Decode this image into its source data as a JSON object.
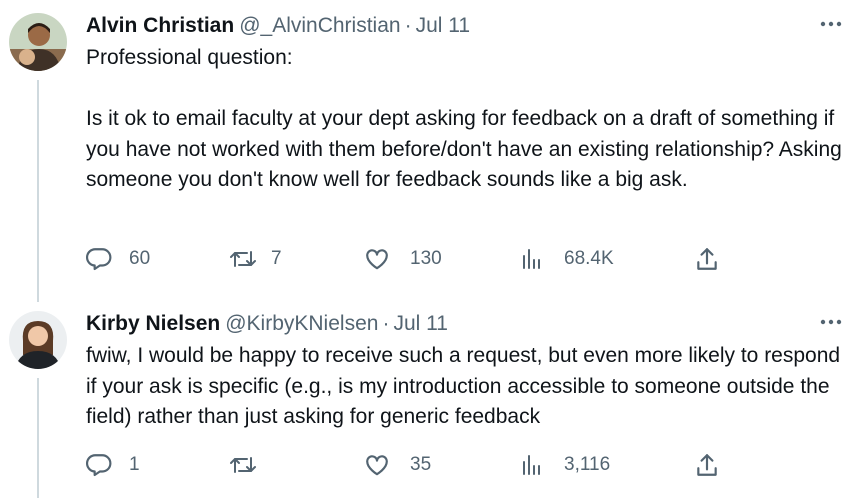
{
  "tweets": [
    {
      "name": "Alvin Christian",
      "handle": "@_AlvinChristian",
      "separator": "·",
      "date": "Jul 11",
      "text": "Professional question:\n\nIs it ok to email faculty at your dept asking for feedback on a draft of something if you have not worked with them before/don't have an existing relationship? Asking someone you don't know well for feedback sounds like a big ask.",
      "replies": "60",
      "retweets": "7",
      "likes": "130",
      "views": "68.4K"
    },
    {
      "name": "Kirby Nielsen",
      "handle": "@KirbyKNielsen",
      "separator": "·",
      "date": "Jul 11",
      "text": "fwiw, I would be happy to receive such a request, but even more likely to respond if your ask is specific (e.g., is my introduction accessible to someone outside the field) rather than just asking for generic feedback",
      "replies": "1",
      "retweets": "",
      "likes": "35",
      "views": "3,116"
    }
  ],
  "icons": {
    "reply": "reply-icon",
    "retweet": "retweet-icon",
    "like": "like-icon",
    "views": "views-icon",
    "share": "share-icon",
    "more": "more-icon"
  },
  "colors": {
    "text": "#0f1419",
    "secondary": "#536471",
    "thread_line": "#cfd9de"
  }
}
